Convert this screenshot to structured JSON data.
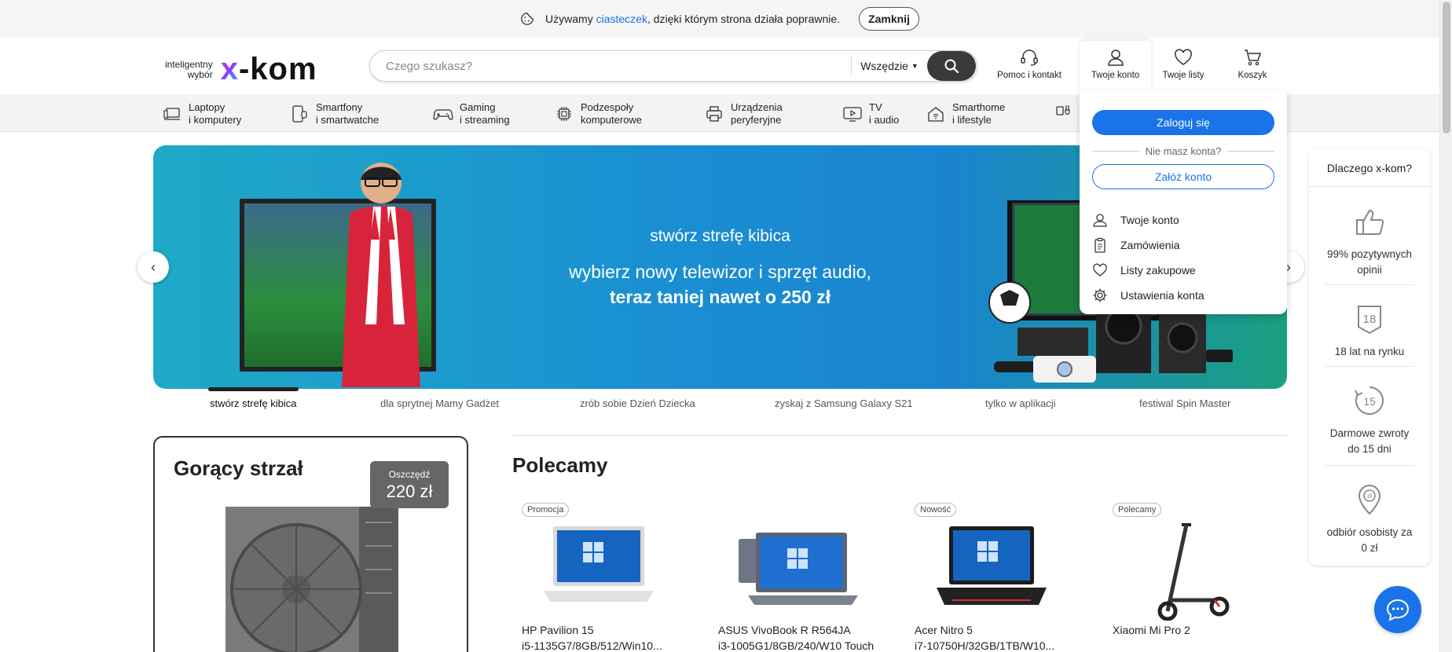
{
  "cookie_bar": {
    "text_before": "Używamy",
    "link": "ciasteczek",
    "text_after": ", dzięki którym strona działa poprawnie.",
    "close_label": "Zamknij"
  },
  "header": {
    "logo_tagline_1": "inteligentny",
    "logo_tagline_2": "wybór",
    "logo_wordmark_x": "x",
    "logo_wordmark_rest": "-kom",
    "search": {
      "placeholder": "Czego szukasz?",
      "scope": "Wszędzie"
    },
    "help_label": "Pomoc i kontakt",
    "account_label": "Twoje konto",
    "lists_label": "Twoje listy",
    "cart_label": "Koszyk"
  },
  "nav": {
    "items": [
      {
        "line1": "Laptopy",
        "line2": "i komputery",
        "icon": "laptop-icon"
      },
      {
        "line1": "Smartfony",
        "line2": "i smartwatche",
        "icon": "smartphone-icon"
      },
      {
        "line1": "Gaming",
        "line2": "i streaming",
        "icon": "gamepad-icon"
      },
      {
        "line1": "Podzespoły",
        "line2": "komputerowe",
        "icon": "cpu-icon"
      },
      {
        "line1": "Urządzenia",
        "line2": "peryferyjne",
        "icon": "printer-icon"
      },
      {
        "line1": "TV",
        "line2": "i audio",
        "icon": "tv-icon"
      },
      {
        "line1": "Smarthome",
        "line2": "i lifestyle",
        "icon": "home-icon"
      }
    ]
  },
  "banner": {
    "line1": "stwórz strefę kibica",
    "line2": "wybierz nowy telewizor i sprzęt audio,",
    "line3": "teraz taniej nawet o 250 zł",
    "tabs": [
      "stwórz strefę kibica",
      "dla sprytnej Mamy Gadżet",
      "zrób sobie Dzień Dziecka",
      "zyskaj z Samsung Galaxy S21",
      "tylko w aplikacji",
      "festiwal Spin Master"
    ]
  },
  "account_dropdown": {
    "login": "Zaloguj się",
    "no_account": "Nie masz konta?",
    "register": "Załóż konto",
    "items": [
      {
        "label": "Twoje konto",
        "icon": "user-icon"
      },
      {
        "label": "Zamówienia",
        "icon": "clipboard-icon"
      },
      {
        "label": "Listy zakupowe",
        "icon": "heart-icon"
      },
      {
        "label": "Ustawienia konta",
        "icon": "gear-icon"
      }
    ]
  },
  "why": {
    "title": "Dlaczego x-kom?",
    "items": [
      {
        "line1": "99% pozytywnych",
        "line2": "opinii",
        "icon": "thumbs-up-icon"
      },
      {
        "line1": "18 lat na rynku",
        "line2": "",
        "icon": "badge-18-icon",
        "badge_text": "18"
      },
      {
        "line1": "Darmowe zwroty",
        "line2": "do 15 dni",
        "icon": "return-15-icon",
        "badge_text": "15"
      },
      {
        "line1": "odbiór osobisty za",
        "line2": "0 zł",
        "icon": "location-pin-icon",
        "badge_text": "zł"
      }
    ]
  },
  "hot_shot": {
    "title": "Gorący strzał",
    "save_label": "Oszczędź",
    "save_value": "220 zł"
  },
  "recommended": {
    "title": "Polecamy",
    "products": [
      {
        "badge": "Promocja",
        "name1": "HP Pavilion 15",
        "name2": "i5-1135G7/8GB/512/Win10..."
      },
      {
        "badge": "",
        "name1": "ASUS VivoBook R R564JA",
        "name2": "i3-1005G1/8GB/240/W10 Touch"
      },
      {
        "badge": "Nowość",
        "name1": "Acer Nitro 5",
        "name2": "i7-10750H/32GB/1TB/W10..."
      },
      {
        "badge": "Polecamy",
        "name1": "Xiaomi Mi Pro 2",
        "name2": ""
      }
    ]
  },
  "colors": {
    "accent": "#1a73e8",
    "dark": "#3a3a3a"
  }
}
